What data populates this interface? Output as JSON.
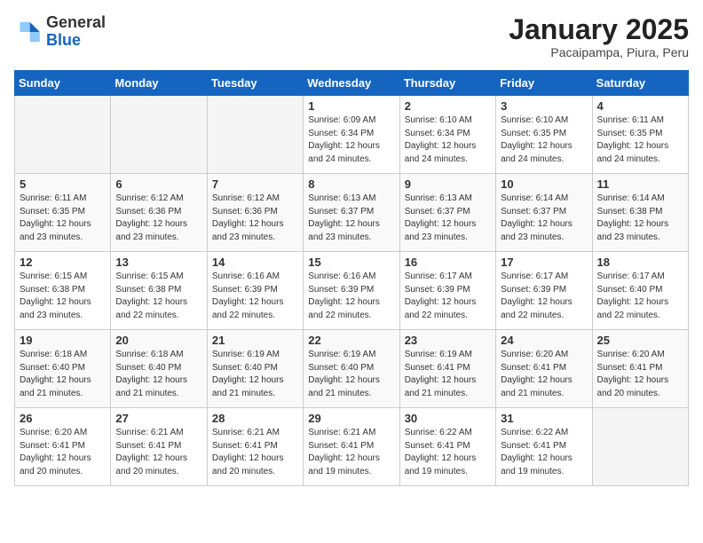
{
  "header": {
    "logo_general": "General",
    "logo_blue": "Blue",
    "month": "January 2025",
    "location": "Pacaipampa, Piura, Peru"
  },
  "weekdays": [
    "Sunday",
    "Monday",
    "Tuesday",
    "Wednesday",
    "Thursday",
    "Friday",
    "Saturday"
  ],
  "weeks": [
    [
      {
        "day": "",
        "info": ""
      },
      {
        "day": "",
        "info": ""
      },
      {
        "day": "",
        "info": ""
      },
      {
        "day": "1",
        "info": "Sunrise: 6:09 AM\nSunset: 6:34 PM\nDaylight: 12 hours\nand 24 minutes."
      },
      {
        "day": "2",
        "info": "Sunrise: 6:10 AM\nSunset: 6:34 PM\nDaylight: 12 hours\nand 24 minutes."
      },
      {
        "day": "3",
        "info": "Sunrise: 6:10 AM\nSunset: 6:35 PM\nDaylight: 12 hours\nand 24 minutes."
      },
      {
        "day": "4",
        "info": "Sunrise: 6:11 AM\nSunset: 6:35 PM\nDaylight: 12 hours\nand 24 minutes."
      }
    ],
    [
      {
        "day": "5",
        "info": "Sunrise: 6:11 AM\nSunset: 6:35 PM\nDaylight: 12 hours\nand 23 minutes."
      },
      {
        "day": "6",
        "info": "Sunrise: 6:12 AM\nSunset: 6:36 PM\nDaylight: 12 hours\nand 23 minutes."
      },
      {
        "day": "7",
        "info": "Sunrise: 6:12 AM\nSunset: 6:36 PM\nDaylight: 12 hours\nand 23 minutes."
      },
      {
        "day": "8",
        "info": "Sunrise: 6:13 AM\nSunset: 6:37 PM\nDaylight: 12 hours\nand 23 minutes."
      },
      {
        "day": "9",
        "info": "Sunrise: 6:13 AM\nSunset: 6:37 PM\nDaylight: 12 hours\nand 23 minutes."
      },
      {
        "day": "10",
        "info": "Sunrise: 6:14 AM\nSunset: 6:37 PM\nDaylight: 12 hours\nand 23 minutes."
      },
      {
        "day": "11",
        "info": "Sunrise: 6:14 AM\nSunset: 6:38 PM\nDaylight: 12 hours\nand 23 minutes."
      }
    ],
    [
      {
        "day": "12",
        "info": "Sunrise: 6:15 AM\nSunset: 6:38 PM\nDaylight: 12 hours\nand 23 minutes."
      },
      {
        "day": "13",
        "info": "Sunrise: 6:15 AM\nSunset: 6:38 PM\nDaylight: 12 hours\nand 22 minutes."
      },
      {
        "day": "14",
        "info": "Sunrise: 6:16 AM\nSunset: 6:39 PM\nDaylight: 12 hours\nand 22 minutes."
      },
      {
        "day": "15",
        "info": "Sunrise: 6:16 AM\nSunset: 6:39 PM\nDaylight: 12 hours\nand 22 minutes."
      },
      {
        "day": "16",
        "info": "Sunrise: 6:17 AM\nSunset: 6:39 PM\nDaylight: 12 hours\nand 22 minutes."
      },
      {
        "day": "17",
        "info": "Sunrise: 6:17 AM\nSunset: 6:39 PM\nDaylight: 12 hours\nand 22 minutes."
      },
      {
        "day": "18",
        "info": "Sunrise: 6:17 AM\nSunset: 6:40 PM\nDaylight: 12 hours\nand 22 minutes."
      }
    ],
    [
      {
        "day": "19",
        "info": "Sunrise: 6:18 AM\nSunset: 6:40 PM\nDaylight: 12 hours\nand 21 minutes."
      },
      {
        "day": "20",
        "info": "Sunrise: 6:18 AM\nSunset: 6:40 PM\nDaylight: 12 hours\nand 21 minutes."
      },
      {
        "day": "21",
        "info": "Sunrise: 6:19 AM\nSunset: 6:40 PM\nDaylight: 12 hours\nand 21 minutes."
      },
      {
        "day": "22",
        "info": "Sunrise: 6:19 AM\nSunset: 6:40 PM\nDaylight: 12 hours\nand 21 minutes."
      },
      {
        "day": "23",
        "info": "Sunrise: 6:19 AM\nSunset: 6:41 PM\nDaylight: 12 hours\nand 21 minutes."
      },
      {
        "day": "24",
        "info": "Sunrise: 6:20 AM\nSunset: 6:41 PM\nDaylight: 12 hours\nand 21 minutes."
      },
      {
        "day": "25",
        "info": "Sunrise: 6:20 AM\nSunset: 6:41 PM\nDaylight: 12 hours\nand 20 minutes."
      }
    ],
    [
      {
        "day": "26",
        "info": "Sunrise: 6:20 AM\nSunset: 6:41 PM\nDaylight: 12 hours\nand 20 minutes."
      },
      {
        "day": "27",
        "info": "Sunrise: 6:21 AM\nSunset: 6:41 PM\nDaylight: 12 hours\nand 20 minutes."
      },
      {
        "day": "28",
        "info": "Sunrise: 6:21 AM\nSunset: 6:41 PM\nDaylight: 12 hours\nand 20 minutes."
      },
      {
        "day": "29",
        "info": "Sunrise: 6:21 AM\nSunset: 6:41 PM\nDaylight: 12 hours\nand 19 minutes."
      },
      {
        "day": "30",
        "info": "Sunrise: 6:22 AM\nSunset: 6:41 PM\nDaylight: 12 hours\nand 19 minutes."
      },
      {
        "day": "31",
        "info": "Sunrise: 6:22 AM\nSunset: 6:41 PM\nDaylight: 12 hours\nand 19 minutes."
      },
      {
        "day": "",
        "info": ""
      }
    ]
  ]
}
